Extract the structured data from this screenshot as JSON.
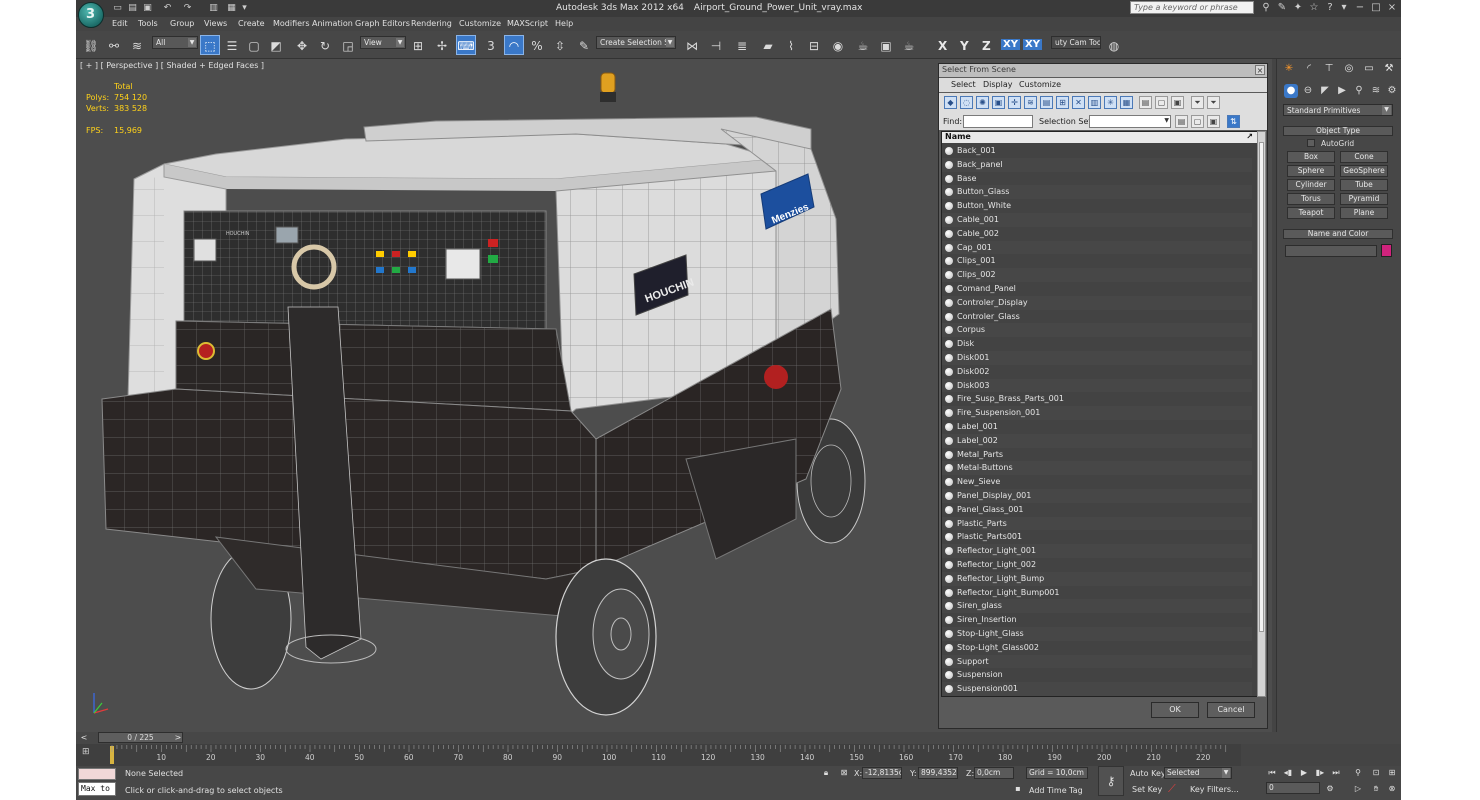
{
  "window": {
    "title": "Autodesk 3ds Max  2012 x64",
    "filename": "Airport_Ground_Power_Unit_vray.max",
    "search_placeholder": "Type a keyword or phrase"
  },
  "menu": [
    "Edit",
    "Tools",
    "Group",
    "Views",
    "Create",
    "Modifiers",
    "Animation",
    "Graph Editors",
    "Rendering",
    "Customize",
    "MAXScript",
    "Help"
  ],
  "toolbar": {
    "filter_value": "All",
    "reference_coord": "View",
    "selection_set": "Create Selection Se",
    "snap_label": "3",
    "angle_snap_label": "%",
    "axis_x": "X",
    "axis_y": "Y",
    "axis_z": "Z",
    "axis_xy": "XY",
    "axis_xy2": "XY",
    "tool_label": "uty Cam Tool v"
  },
  "viewport": {
    "label": "[ + ] [ Perspective ] [ Shaded + Edged Faces ]",
    "stats_header": "Total",
    "polys_label": "Polys:",
    "polys_value": "754 120",
    "verts_label": "Verts:",
    "verts_value": "383 528",
    "fps_label": "FPS:",
    "fps_value": "15,969",
    "model_brand": "HOUCHIN",
    "model_logo_text": "Menzies",
    "panel_brand": "HOUCHIN"
  },
  "dialog": {
    "title": "Select From Scene",
    "menu": [
      "Select",
      "Display",
      "Customize"
    ],
    "find_label": "Find:",
    "selection_set_label": "Selection Set:",
    "column_name": "Name",
    "ok_label": "OK",
    "cancel_label": "Cancel",
    "items": [
      "Back_001",
      "Back_panel",
      "Base",
      "Button_Glass",
      "Button_White",
      "Cable_001",
      "Cable_002",
      "Cap_001",
      "Clips_001",
      "Clips_002",
      "Comand_Panel",
      "Controler_Display",
      "Controler_Glass",
      "Corpus",
      "Disk",
      "Disk001",
      "Disk002",
      "Disk003",
      "Fire_Susp_Brass_Parts_001",
      "Fire_Suspension_001",
      "Label_001",
      "Label_002",
      "Metal_Parts",
      "Metal-Buttons",
      "New_Sieve",
      "Panel_Display_001",
      "Panel_Glass_001",
      "Plastic_Parts",
      "Plastic_Parts001",
      "Reflector_Light_001",
      "Reflector_Light_002",
      "Reflector_Light_Bump",
      "Reflector_Light_Bump001",
      "Siren_glass",
      "Siren_Insertion",
      "Stop-Light_Glass",
      "Stop-Light_Glass002",
      "Support",
      "Suspension",
      "Suspension001"
    ]
  },
  "command_panel": {
    "dropdown": "Standard Primitives",
    "object_type_title": "Object Type",
    "autogrid_label": "AutoGrid",
    "buttons": [
      "Box",
      "Cone",
      "Sphere",
      "GeoSphere",
      "Cylinder",
      "Tube",
      "Torus",
      "Pyramid",
      "Teapot",
      "Plane"
    ],
    "name_color_title": "Name and Color",
    "color_swatch": "#d0237d"
  },
  "timeline": {
    "frame_label": "0 / 225",
    "ticks": [
      "10",
      "20",
      "30",
      "40",
      "50",
      "60",
      "70",
      "80",
      "90",
      "100",
      "110",
      "120",
      "130",
      "140",
      "150",
      "160",
      "170",
      "180",
      "190",
      "200",
      "210",
      "220"
    ]
  },
  "status": {
    "maxscript_label": "Max to",
    "selection_status": "None Selected",
    "prompt": "Click or click-and-drag to select objects",
    "x_label": "X:",
    "x_value": "-12,8135cr",
    "y_label": "Y:",
    "y_value": "899,4352cr",
    "z_label": "Z:",
    "z_value": "0,0cm",
    "grid": "Grid = 10,0cm",
    "add_time_tag": "Add Time Tag",
    "auto_key": "Auto Key",
    "set_key": "Set Key",
    "key_mode": "Selected",
    "key_filters": "Key Filters...",
    "frame_value": "0"
  },
  "colors": {
    "active_blue": "#3a78c8",
    "stats_yellow": "#ffd21a"
  }
}
